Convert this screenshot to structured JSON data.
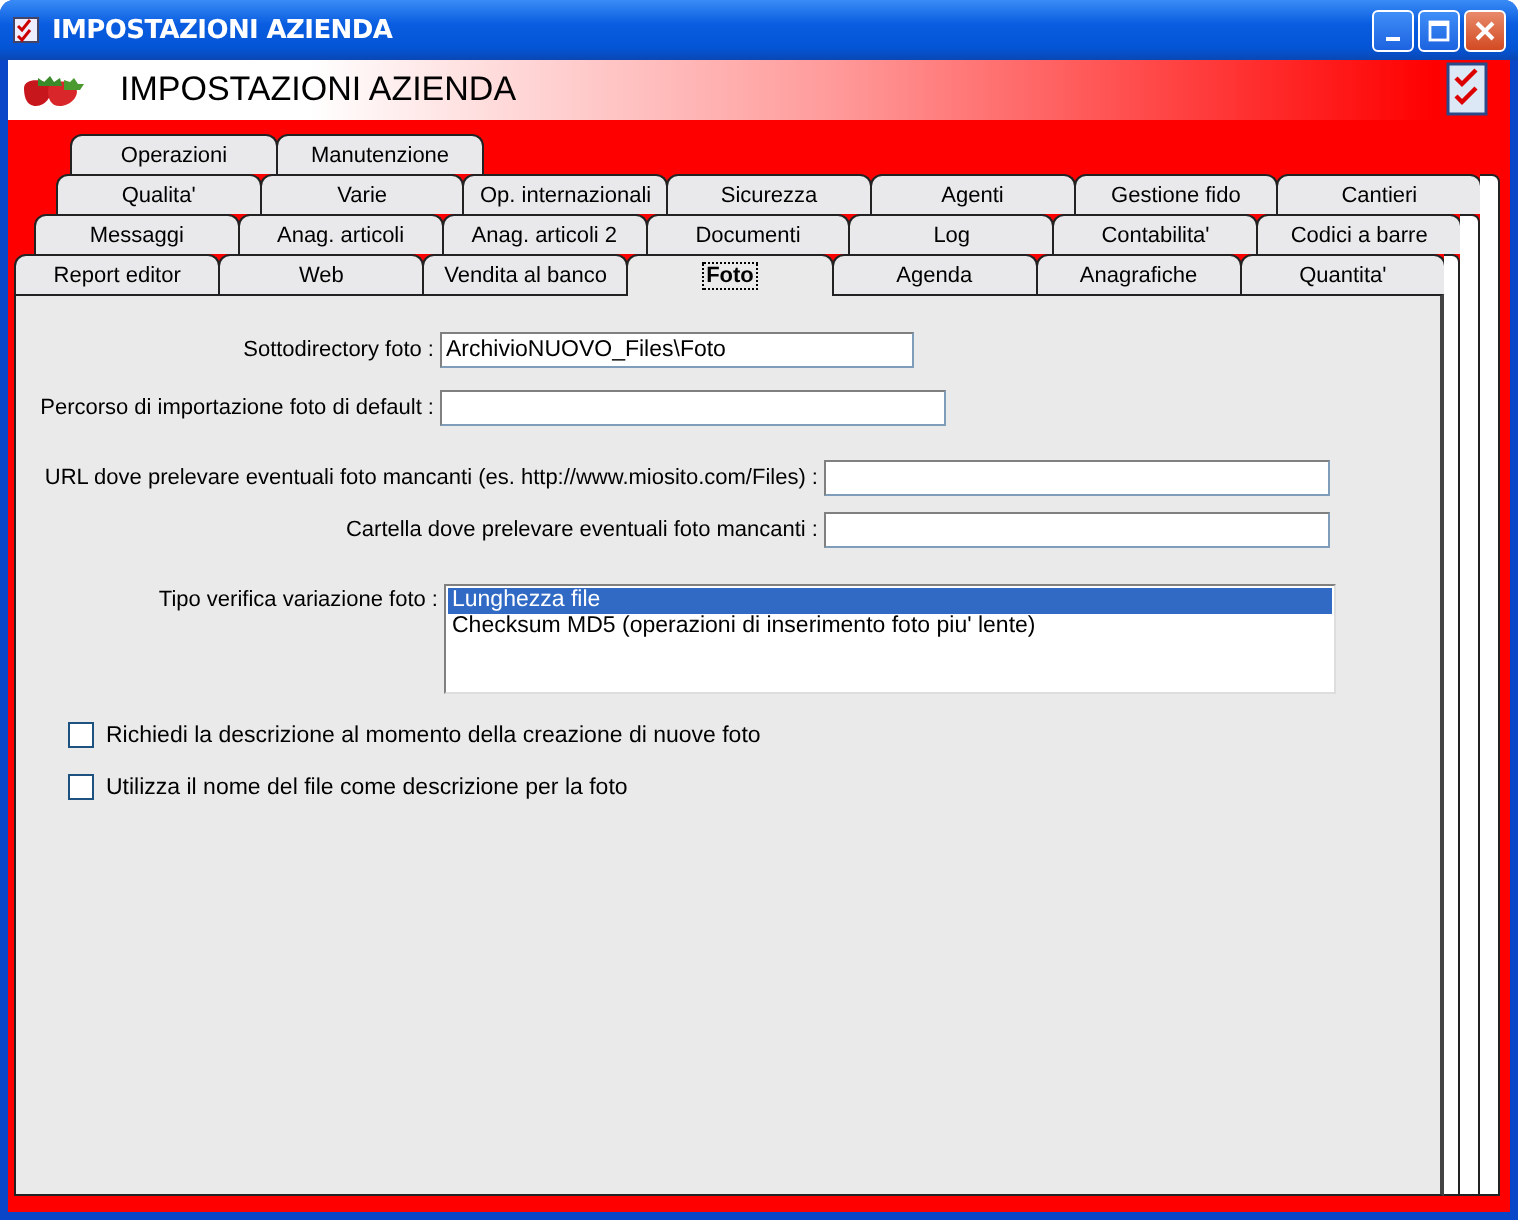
{
  "window": {
    "title": "IMPOSTAZIONI AZIENDA"
  },
  "header": {
    "title": "IMPOSTAZIONI AZIENDA"
  },
  "tab_rows": [
    {
      "tabs": [
        {
          "label": "Operazioni",
          "selected": false
        },
        {
          "label": "Manutenzione",
          "selected": false
        }
      ]
    },
    {
      "tabs": [
        {
          "label": "Qualita'",
          "selected": false
        },
        {
          "label": "Varie",
          "selected": false
        },
        {
          "label": "Op. internazionali",
          "selected": false
        },
        {
          "label": "Sicurezza",
          "selected": false
        },
        {
          "label": "Agenti",
          "selected": false
        },
        {
          "label": "Gestione fido",
          "selected": false
        },
        {
          "label": "Cantieri",
          "selected": false
        }
      ]
    },
    {
      "tabs": [
        {
          "label": "Messaggi",
          "selected": false
        },
        {
          "label": "Anag. articoli",
          "selected": false
        },
        {
          "label": "Anag. articoli 2",
          "selected": false
        },
        {
          "label": "Documenti",
          "selected": false
        },
        {
          "label": "Log",
          "selected": false
        },
        {
          "label": "Contabilita'",
          "selected": false
        },
        {
          "label": "Codici a barre",
          "selected": false
        }
      ]
    },
    {
      "tabs": [
        {
          "label": "Report editor",
          "selected": false
        },
        {
          "label": "Web",
          "selected": false
        },
        {
          "label": "Vendita al banco",
          "selected": false
        },
        {
          "label": "Foto",
          "selected": true
        },
        {
          "label": "Agenda",
          "selected": false
        },
        {
          "label": "Anagrafiche",
          "selected": false
        },
        {
          "label": "Quantita'",
          "selected": false
        }
      ]
    }
  ],
  "local_fields": [
    {
      "label": "Sottodirectory foto :",
      "value": "ArchivioNUOVO_Files\\Foto"
    },
    {
      "label": "Percorso di importazione foto di default :"
    }
  ],
  "remote_fields": [
    {
      "label": "URL dove prelevare eventuali foto mancanti (es. http://www.miosito.com/Files) :"
    },
    {
      "label": "Cartella dove prelevare eventuali foto mancanti :"
    }
  ],
  "verify_list": {
    "label": "Tipo verifica variazione foto :",
    "options": [
      {
        "label": "Lunghezza file",
        "selected": true
      },
      {
        "label": "Checksum MD5 (operazioni di inserimento foto piu' lente)",
        "selected": false
      }
    ]
  },
  "checkboxes": [
    {
      "label": "Richiedi la descrizione al momento della creazione di nuove foto",
      "checked": false
    },
    {
      "label": "Utilizza il nome del file come descrizione per la foto",
      "checked": false
    }
  ]
}
